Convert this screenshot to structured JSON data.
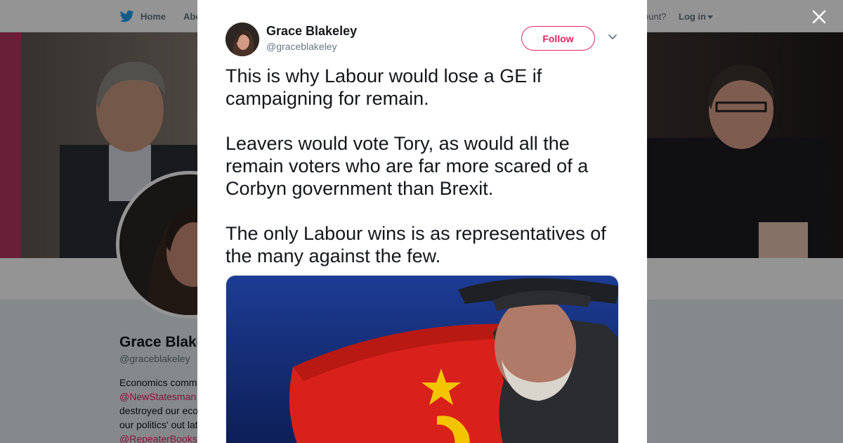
{
  "background": {
    "nav": {
      "home_label": "Home",
      "about_label": "Abo",
      "account_question": "ccount?",
      "login_label": "Log in"
    },
    "profile": {
      "name": "Grace Blake",
      "handle": "@graceblakeley",
      "bio_lines": [
        "Economics comm",
        "@NewStatesman",
        "destroyed our eco",
        "our politics' out lat",
        "@RepeaterBooks"
      ]
    }
  },
  "tweet": {
    "author_name": "Grace Blakeley",
    "author_handle": "@graceblakeley",
    "follow_label": "Follow",
    "paragraphs": [
      "This is why Labour would lose a GE if campaigning for remain.",
      "Leavers would vote Tory, as would all the remain voters who are far more scared of a Corbyn government than Brexit.",
      "The only Labour wins is as representatives of the many against the few."
    ]
  },
  "colors": {
    "accent": "#e0245e",
    "twitter_blue": "#1da1f2",
    "muted_text": "#657786",
    "flag_red": "#d9211c",
    "flag_star": "#f5c400",
    "media_bg": "#1b3a8c"
  },
  "icons": {
    "home": "twitter-bird-icon",
    "close": "close-icon",
    "more": "chevron-down-icon"
  }
}
